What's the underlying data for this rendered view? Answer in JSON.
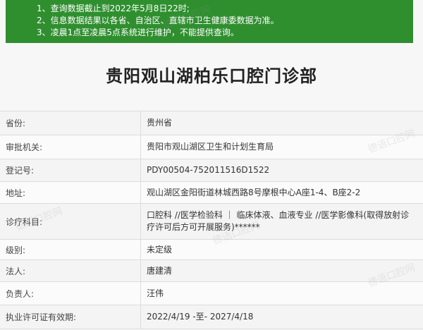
{
  "notice": {
    "lines": [
      "1、查询数据截止到2022年5月8日22时;",
      "2、信息数据结果以各省、自治区、直辖市卫生健康委数据为准。",
      "3、凌晨1点至凌晨5点系统进行维护，不能提供查询。"
    ]
  },
  "page_title": "贵阳观山湖柏乐口腔门诊部",
  "rows": [
    {
      "label": "省份:",
      "value": "贵州省"
    },
    {
      "label": "审批机关:",
      "value": "贵阳市观山湖区卫生和计划生育局"
    },
    {
      "label": "登记号:",
      "value": "PDY00504-752011516D1522"
    },
    {
      "label": "地址:",
      "value": "观山湖区金阳街道林城西路8号摩根中心A座1-4、B座2-2"
    },
    {
      "label": "诊疗科目:",
      "value": "口腔科 //医学检验科 ｜ 临床体液、血液专业 //医学影像科(取得放射诊疗许可后方可开展服务)******"
    },
    {
      "label": "级别:",
      "value": "未定级"
    },
    {
      "label": "法人:",
      "value": "唐建清"
    },
    {
      "label": "负责人:",
      "value": "汪伟"
    },
    {
      "label": "执业许可证有效期:",
      "value": "2022/4/19 -至- 2027/4/18"
    }
  ],
  "watermark": "德语口腔网",
  "colors": {
    "notice_bg": "#2f8f2f",
    "page_bg": "#f7f7f7"
  }
}
